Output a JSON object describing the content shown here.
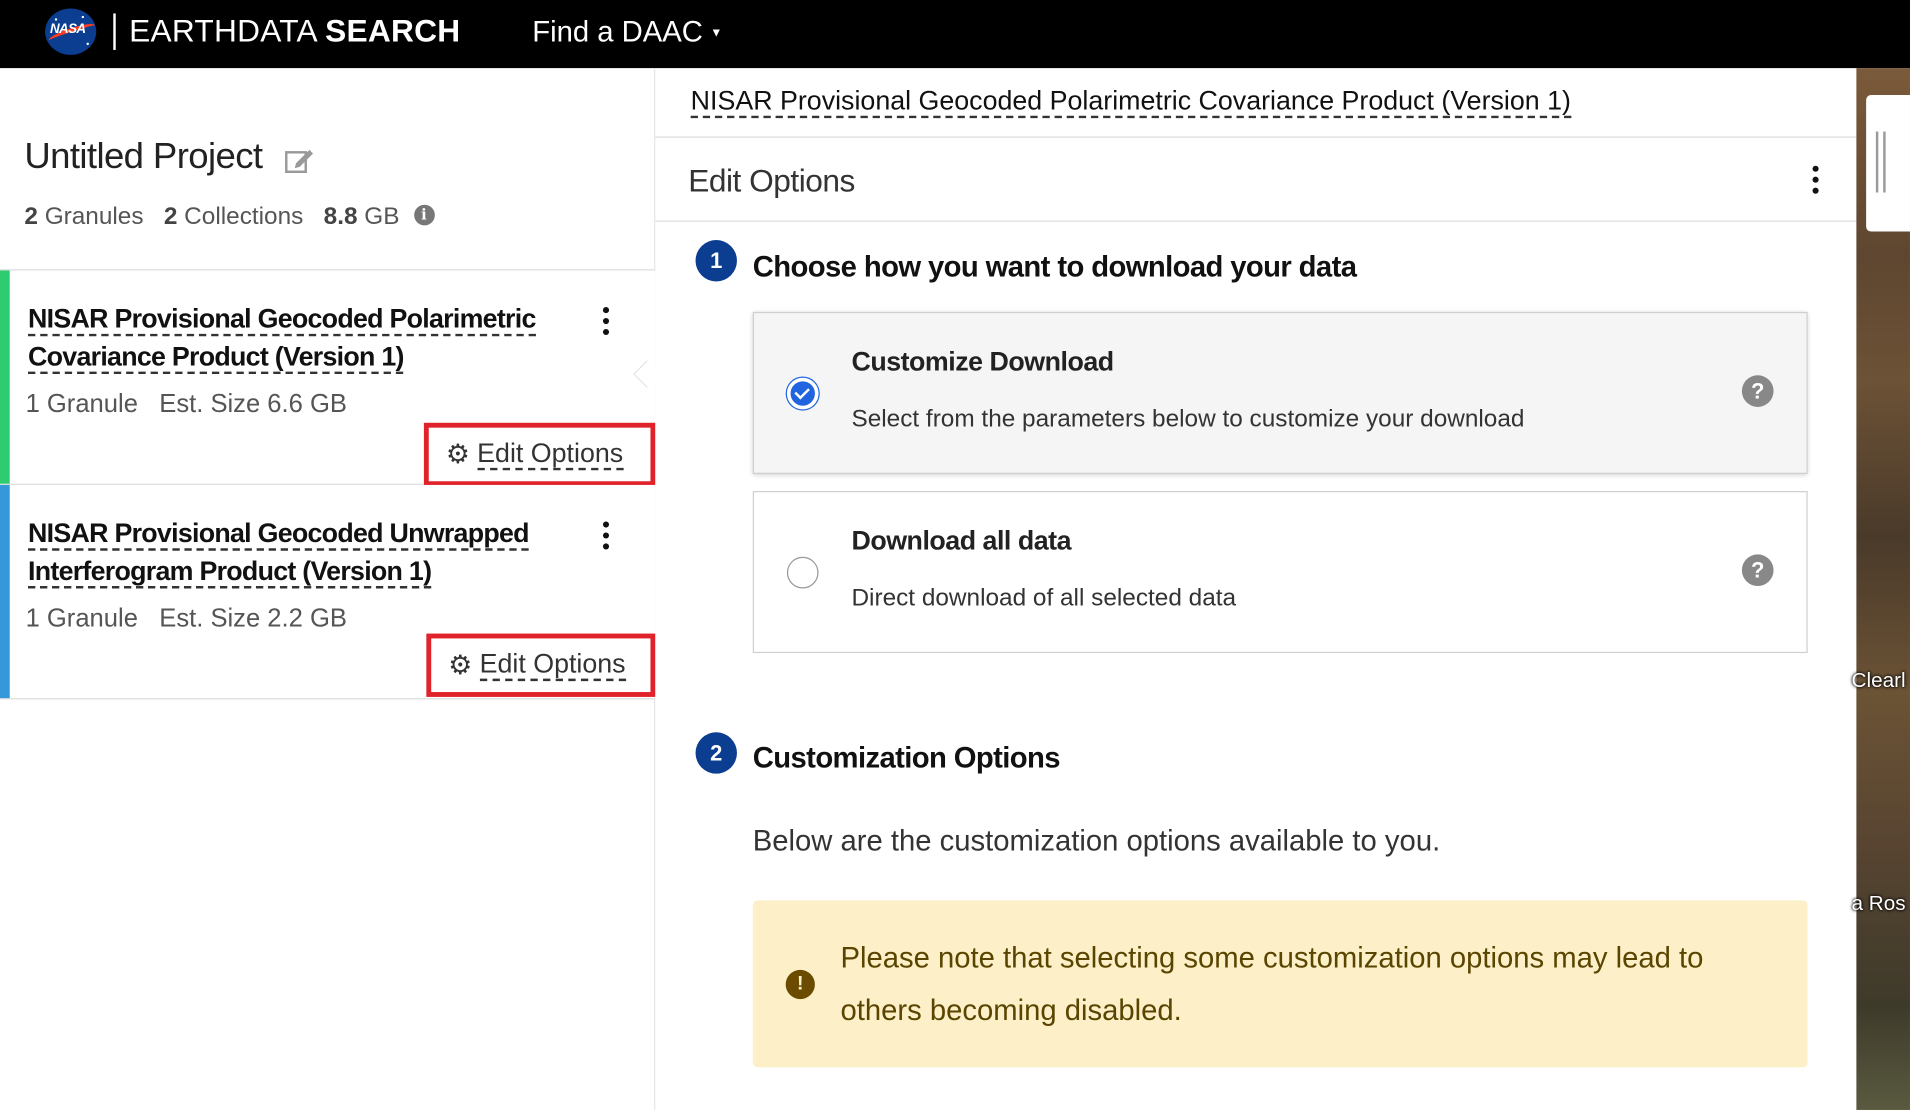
{
  "header": {
    "logo_text": "NASA",
    "brand_prefix": "EARTHDATA",
    "brand_suffix": "SEARCH",
    "find_daac": "Find a DAAC",
    "colors": {
      "bar": "#000000",
      "nasa_blue": "#0b3d91",
      "nasa_red": "#fc3d21"
    }
  },
  "project": {
    "title": "Untitled Project",
    "granules_count": "2",
    "granules_label": "Granules",
    "collections_count": "2",
    "collections_label": "Collections",
    "size_value": "8.8",
    "size_unit": "GB"
  },
  "collections": [
    {
      "title": "NISAR Provisional Geocoded Polarimetric Covariance Product (Version 1)",
      "granules": "1 Granule",
      "est_size": "Est. Size 6.6 GB",
      "edit_label": "Edit Options",
      "stripe_color": "#2ecc71"
    },
    {
      "title": "NISAR Provisional Geocoded Unwrapped Interferogram Product (Version 1)",
      "granules": "1 Granule",
      "est_size": "Est. Size 2.2 GB",
      "edit_label": "Edit Options",
      "stripe_color": "#3498db"
    }
  ],
  "panel": {
    "collection_title": "NISAR Provisional Geocoded Polarimetric Covariance Product (Version 1)",
    "subtitle": "Edit Options",
    "step1": {
      "num": "1",
      "title": "Choose how you want to download your data"
    },
    "options": [
      {
        "title": "Customize Download",
        "desc": "Select from the parameters below to customize your download",
        "selected": true
      },
      {
        "title": "Download all data",
        "desc": "Direct download of all selected data",
        "selected": false
      }
    ],
    "step2": {
      "num": "2",
      "title": "Customization Options"
    },
    "customization_desc": "Below are the customization options available to you.",
    "notice": "Please note that selecting some customization options may lead to others becoming disabled."
  },
  "map": {
    "labels": [
      "Clearl",
      "a Ros"
    ]
  }
}
